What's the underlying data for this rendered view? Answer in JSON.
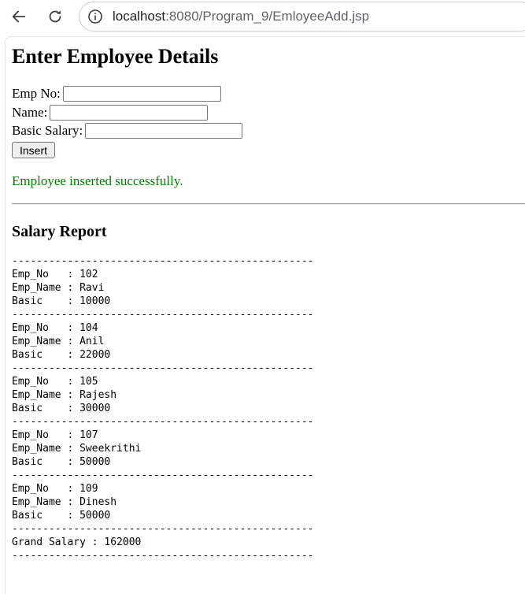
{
  "browser": {
    "url_host": "localhost",
    "url_path": ":8080/Program_9/EmloyeeAdd.jsp"
  },
  "page": {
    "title": "Enter Employee Details",
    "form": {
      "emp_no_label": "Emp No:",
      "emp_no_value": "",
      "name_label": "Name:",
      "name_value": "",
      "basic_salary_label": "Basic Salary:",
      "basic_salary_value": "",
      "insert_label": "Insert"
    },
    "message": "Employee inserted successfully.",
    "report_title": "Salary Report",
    "report_lines": [
      "-------------------------------------------------",
      "Emp_No   : 102",
      "Emp_Name : Ravi",
      "Basic    : 10000",
      "-------------------------------------------------",
      "Emp_No   : 104",
      "Emp_Name : Anil",
      "Basic    : 22000",
      "-------------------------------------------------",
      "Emp_No   : 105",
      "Emp_Name : Rajesh",
      "Basic    : 30000",
      "-------------------------------------------------",
      "Emp_No   : 107",
      "Emp_Name : Sweekrithi",
      "Basic    : 50000",
      "-------------------------------------------------",
      "Emp_No   : 109",
      "Emp_Name : Dinesh",
      "Basic    : 50000",
      "-------------------------------------------------",
      "Grand Salary : 162000",
      "-------------------------------------------------"
    ],
    "colors": {
      "success": "#008000"
    }
  }
}
